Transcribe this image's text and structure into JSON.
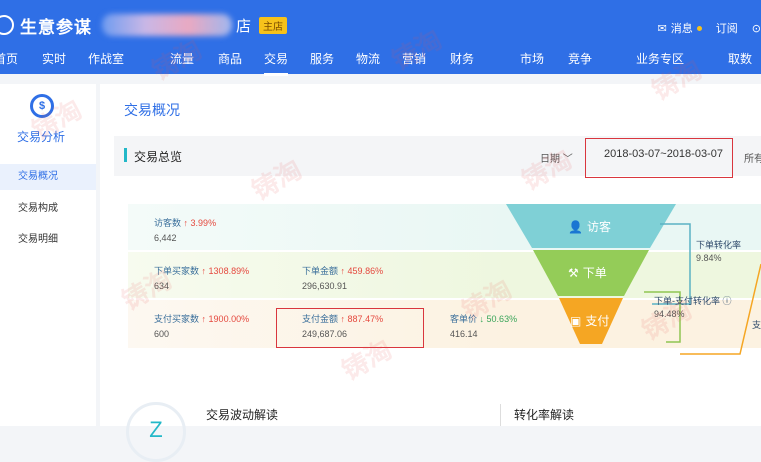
{
  "header": {
    "brand": "生意参谋",
    "shop_suffix": "店",
    "role_badge": "主店",
    "messages": "消息",
    "subscribe": "订阅",
    "nav": [
      "首页",
      "实时",
      "作战室",
      "流量",
      "商品",
      "交易",
      "服务",
      "物流",
      "营销",
      "财务",
      "市场",
      "竞争",
      "业务专区",
      "取数"
    ],
    "active_nav": "交易"
  },
  "sidebar": {
    "icon_glyph": "$",
    "title": "交易分析",
    "items": [
      "交易概况",
      "交易构成",
      "交易明细"
    ],
    "selected": "交易概况"
  },
  "main": {
    "title": "交易概况",
    "section": "交易总览",
    "date_label": "日期",
    "date_range": "2018-03-07~2018-03-07",
    "all_label": "所有"
  },
  "metrics": {
    "visitors": {
      "name": "访客数",
      "change": "3.99%",
      "value": "6,442",
      "dir": "up"
    },
    "order_buyers": {
      "name": "下单买家数",
      "change": "1308.89%",
      "value": "634",
      "dir": "up"
    },
    "order_amount": {
      "name": "下单金额",
      "change": "459.86%",
      "value": "296,630.91",
      "dir": "up"
    },
    "pay_buyers": {
      "name": "支付买家数",
      "change": "1900.00%",
      "value": "600",
      "dir": "up"
    },
    "pay_amount": {
      "name": "支付金额",
      "change": "887.47%",
      "value": "249,687.06",
      "dir": "up"
    },
    "unit_price": {
      "name": "客单价",
      "change": "50.63%",
      "value": "416.14",
      "dir": "down"
    }
  },
  "funnel": {
    "stage1": "访客",
    "stage2": "下单",
    "stage3": "支付",
    "colors": {
      "stage1": "#7fd0d6",
      "stage2": "#94cc58",
      "stage3": "#f5a623"
    },
    "conv1_label": "下单转化率",
    "conv1_value": "9.84%",
    "conv2_label": "下单-支付转化率",
    "conv2_value": "94.48%",
    "conv3_label": "支"
  },
  "bottom": {
    "circle_glyph": "Z",
    "wave_title": "交易波动解读",
    "conv_title": "转化率解读"
  },
  "watermark": "铸淘"
}
